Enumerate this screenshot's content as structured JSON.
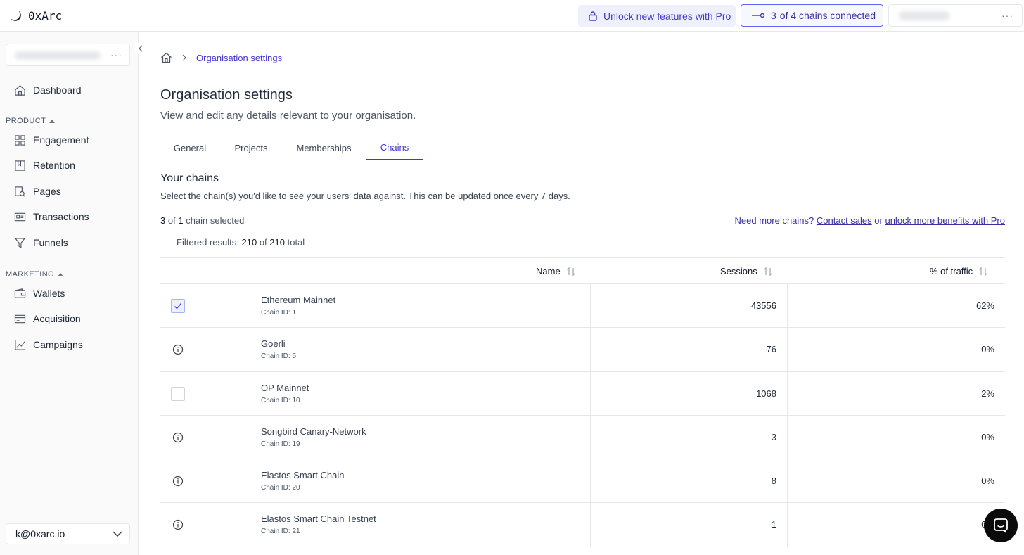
{
  "app": {
    "name": "0xArc"
  },
  "topbar": {
    "pro_label": "Unlock new features with Pro",
    "chains_count": "3",
    "chains_label": "of 4 chains connected",
    "more_label": "···"
  },
  "sidebar": {
    "org_more": "···",
    "dashboard": "Dashboard",
    "product_label": "PRODUCT",
    "product_items": [
      "Engagement",
      "Retention",
      "Pages",
      "Transactions",
      "Funnels"
    ],
    "marketing_label": "MARKETING",
    "marketing_items": [
      "Wallets",
      "Acquisition",
      "Campaigns"
    ],
    "user_email": "k@0xarc.io"
  },
  "breadcrumb": {
    "current": "Organisation settings"
  },
  "page": {
    "title": "Organisation settings",
    "subtitle": "View and edit any details relevant to your organisation."
  },
  "tabs": [
    "General",
    "Projects",
    "Memberships",
    "Chains"
  ],
  "chains": {
    "title": "Your chains",
    "description": "Select the chain(s) you'd like to see your users' data against. This can be updated once every 7 days.",
    "selected_count": "3",
    "selected_of": "of",
    "selected_total": "1",
    "selected_suffix": "chain selected",
    "more_prefix": "Need more chains?",
    "contact_sales": "Contact sales",
    "or": "or",
    "unlock_link": "unlock more benefits with Pro",
    "filter_prefix": "Filtered results:",
    "filter_count": "210",
    "filter_of": "of",
    "filter_total": "210",
    "filter_suffix": "total"
  },
  "table": {
    "headers": {
      "name": "Name",
      "sessions": "Sessions",
      "traffic": "% of traffic"
    },
    "rows": [
      {
        "state": "checked",
        "name": "Ethereum Mainnet",
        "chain_id": "Chain ID: 1",
        "sessions": "43556",
        "traffic": "62%"
      },
      {
        "state": "info",
        "name": "Goerli",
        "chain_id": "Chain ID: 5",
        "sessions": "76",
        "traffic": "0%"
      },
      {
        "state": "unchecked",
        "name": "OP Mainnet",
        "chain_id": "Chain ID: 10",
        "sessions": "1068",
        "traffic": "2%"
      },
      {
        "state": "info",
        "name": "Songbird Canary-Network",
        "chain_id": "Chain ID: 19",
        "sessions": "3",
        "traffic": "0%"
      },
      {
        "state": "info",
        "name": "Elastos Smart Chain",
        "chain_id": "Chain ID: 20",
        "sessions": "8",
        "traffic": "0%"
      },
      {
        "state": "info",
        "name": "Elastos Smart Chain Testnet",
        "chain_id": "Chain ID: 21",
        "sessions": "1",
        "traffic": "0%"
      }
    ]
  },
  "colors": {
    "accent": "#4338ca",
    "border": "#e5e7eb",
    "sidebar_bg": "#fafafa"
  }
}
